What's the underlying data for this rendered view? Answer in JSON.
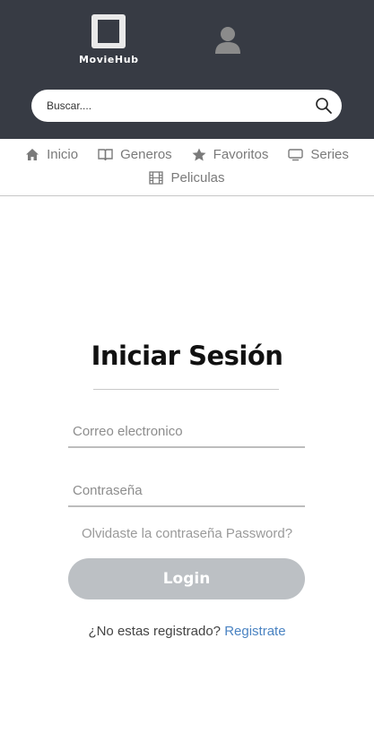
{
  "header": {
    "logo_text": "MovieHub",
    "search": {
      "placeholder": "Buscar....",
      "value": ""
    }
  },
  "nav": {
    "items": [
      {
        "label": "Inicio",
        "icon": "home-icon"
      },
      {
        "label": "Generos",
        "icon": "book-icon"
      },
      {
        "label": "Favoritos",
        "icon": "star-icon"
      },
      {
        "label": "Series",
        "icon": "tv-icon"
      },
      {
        "label": "Peliculas",
        "icon": "film-icon"
      }
    ]
  },
  "login": {
    "title": "Iniciar Sesión",
    "email_placeholder": "Correo electronico",
    "password_placeholder": "Contraseña",
    "forgot_text": "Olvidaste la contraseña Password?",
    "button_label": "Login",
    "register_prompt": "¿No estas registrado?",
    "register_link": "Registrate"
  },
  "colors": {
    "header_bg": "#373b44",
    "button_bg": "#bcc0c4",
    "link": "#4a83c2",
    "nav_text": "#7a7a7a"
  }
}
